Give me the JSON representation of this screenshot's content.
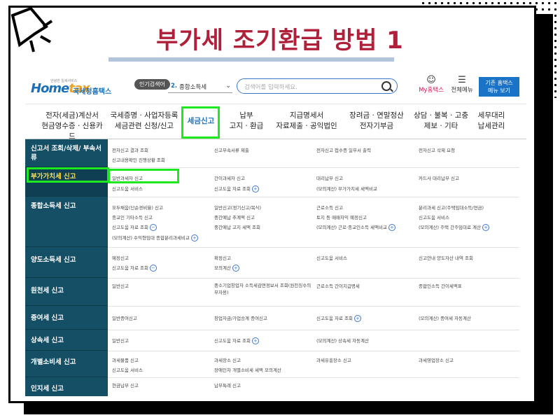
{
  "slide": {
    "title": "부가세 조기환급 방법 1"
  },
  "header": {
    "logo_small": "안녕한 일세서비스",
    "logo_home": "Home",
    "logo_tax": "tax",
    "logo_org": "국세청홈택스",
    "popular_badge": "인기검색어",
    "popular_rank": "2.",
    "popular_term": "종합소득세",
    "search_placeholder": "검색어를 입력하세요.",
    "my_home": "My홈택스",
    "all_menu": "전체메뉴",
    "old_site_line1": "기존 홈택스",
    "old_site_line2": "메뉴 보기"
  },
  "nav": [
    {
      "line1": "전자(세금)계산서",
      "line2": "현금영수증 · 신용카드"
    },
    {
      "line1": "국세증명 · 사업자등록",
      "line2": "세금관련 신청/신고"
    },
    {
      "line1": "세금신고",
      "line2": ""
    },
    {
      "line1": "납부",
      "line2": "고지 · 환급"
    },
    {
      "line1": "지급명세서",
      "line2": "자료제출 · 공익법인"
    },
    {
      "line1": "장려금 · 연말정산",
      "line2": "전자기부금"
    },
    {
      "line1": "상담 · 불복 · 고충",
      "line2": "제보 · 기타"
    },
    {
      "line1": "세무대리",
      "line2": "납세관리"
    }
  ],
  "menu": {
    "rows": [
      {
        "category": "신고서 조회/삭제/ 부속서류",
        "items": [
          "전자신고 결과 조회",
          "신고부속서류 제출",
          "전자신고 접수증 일부서 출력",
          "전자신고 삭제 요청",
          "신고내용확인 진행상황 조회"
        ]
      },
      {
        "category": "부가가치세 신고",
        "items": [
          "일반과세자 신고",
          "간이과세자 신고",
          "대리납부 신고",
          "카드사 대리납부 신고",
          "신고도움 서비스",
          "신고도움 자료 조회",
          "(모의계산) 부가가치세 세액비교"
        ]
      },
      {
        "category": "종합소득세 신고",
        "items": [
          "모두채움(단순경비율) 신고",
          "일반신고(정기신고/복식)",
          "근로소득 신고",
          "분리과세 신고(주택임대소득/연금)",
          "종교인 기타소득 신고",
          "중간예납 추계액 신고",
          "토지 등 매매차익 예정신고",
          "신고도움 서비스",
          "신고도움 자료 조회",
          "중간예납 고지 세액 조회",
          "(모의계산) 근로·종교인소득 세액비교",
          "(모의계산) 주택 간주임대료 계산",
          "(모의계산) 수익형임대 종합분리과세비교"
        ]
      },
      {
        "category": "양도소득세 신고",
        "items": [
          "예정신고",
          "확정신고",
          "신고도움 서비스",
          "신고안내 양도자산 내역 조회",
          "신고도움 자료 조회",
          "모의계산"
        ]
      },
      {
        "category": "원천세 신고",
        "items": [
          "일반신고",
          "중소기업창업자 소득세감면정보서 조회(원천징수의무자용)",
          "근로소득 간이지급명세",
          "종합인소득 간이세액표"
        ]
      },
      {
        "category": "증여세 신고",
        "items": [
          "일반증여신고",
          "창업자금/가업승계 증여신고",
          "신고도움 자료 조회",
          "(모의계산) 증여세 자동계산"
        ]
      },
      {
        "category": "상속세 신고",
        "items": [
          "일반신고",
          "신고도움 자료 조회",
          "(모의계산) 상속세 자동계산"
        ]
      },
      {
        "category": "개별소비세 신고",
        "items": [
          "과세물품 신고",
          "과세장소 신고",
          "과세유흥장소 신고",
          "과세영업장소 신고",
          "신고도움 서비스",
          "장애인차 개별소비세 세액 모의계산"
        ]
      },
      {
        "category": "인지세 신고",
        "items": [
          "현금납부 신고",
          "납부특례 신고"
        ]
      }
    ]
  },
  "colors": {
    "title_red": "#b0203a",
    "highlight_green": "#1ee91e",
    "sidebar": "#144f66",
    "brand_blue": "#1a6fb6"
  }
}
